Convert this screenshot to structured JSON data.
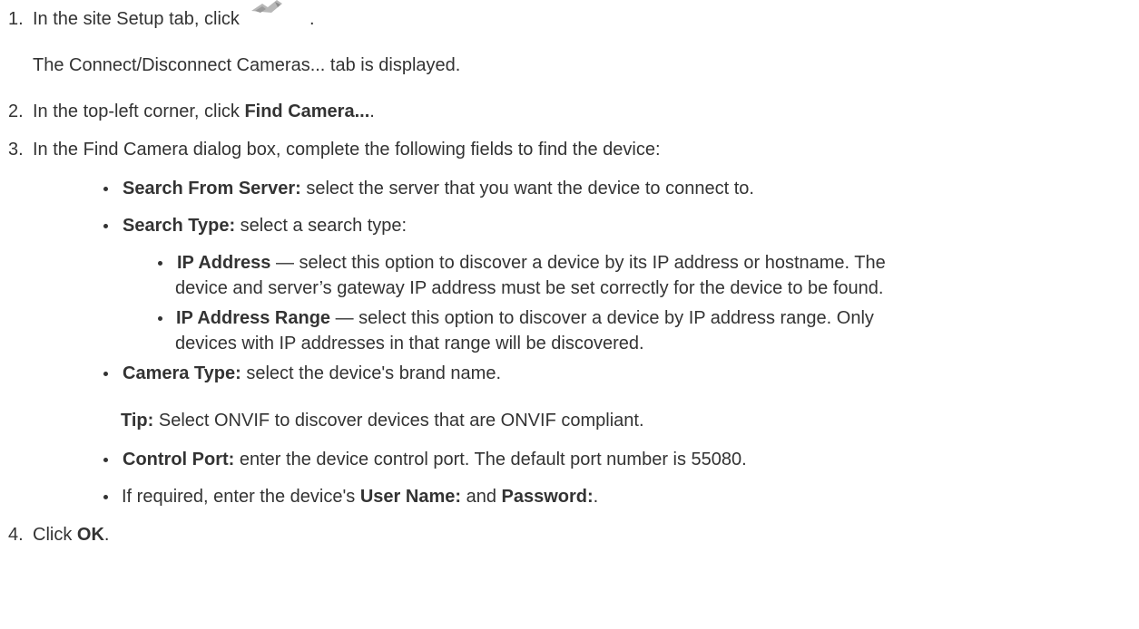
{
  "steps": [
    {
      "number": "1.",
      "text_before": "In the site Setup tab, click",
      "text_after": ".",
      "icon": "connect-cameras-icon",
      "result": "The Connect/Disconnect Cameras... tab is displayed."
    },
    {
      "number": "2.",
      "text_before": "In the top-left corner, click ",
      "bold": "Find Camera...",
      "text_after": "."
    },
    {
      "number": "3.",
      "text": "In the Find Camera dialog box, complete the following fields to find the device:",
      "fields": [
        {
          "label": "Search From Server:",
          "text": " select the server that you want the device to connect to."
        },
        {
          "label": "Search Type:",
          "text": " select a search type:",
          "options": [
            {
              "label": "IP Address",
              "line1": " — select this option to discover a device by its IP address or hostname. The",
              "line2": "device and server’s gateway IP address must be set correctly for the device to be found."
            },
            {
              "label": "IP Address Range",
              "line1": " — select this option to discover a device by IP address range. Only",
              "line2": "devices with IP addresses in that range will be discovered."
            }
          ]
        },
        {
          "label": "Camera Type:",
          "text": " select the device's brand name.",
          "tip_label": "Tip:",
          "tip_text": " Select ONVIF to discover devices that are ONVIF compliant."
        },
        {
          "label": "Control Port:",
          "text": " enter the device control port. The default port number is 55080."
        },
        {
          "text_before": "If required, enter the device's ",
          "label": "User Name:",
          "text_middle": " and ",
          "label2": "Password:",
          "text_after": "."
        }
      ]
    },
    {
      "number": "4.",
      "text_before": "Click ",
      "bold": "OK",
      "text_after": "."
    }
  ]
}
